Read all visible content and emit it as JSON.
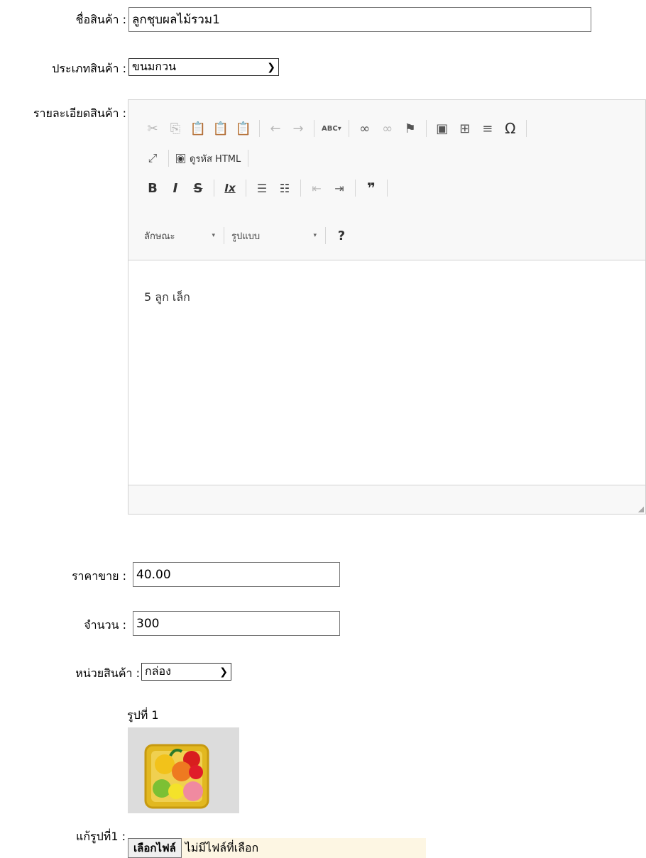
{
  "form": {
    "name_label": "ชื่อสินค้า :",
    "name_value": "ลูกชุบผลไม้รวม1",
    "type_label": "ประเภทสินค้า :",
    "type_value": "ขนมกวน",
    "detail_label": "รายละเอียดสินค้า :",
    "price_label": "ราคาขาย :",
    "price_value": "40.00",
    "qty_label": "จำนวน :",
    "qty_value": "300",
    "unit_label": "หน่วยสินค้า :",
    "unit_value": "กล่อง",
    "image_caption": "รูปที่ 1",
    "edit_image_label": "แก้รูปที่1 :",
    "file_button": "เลือกไฟล์",
    "file_status": "ไม่มีไฟล์ที่เลือก"
  },
  "editor": {
    "content": "5 ลูก เล็ก",
    "source_label": "ดูรหัส HTML",
    "format_label": "ลักษณะ",
    "style_label": "รูปแบบ",
    "help_label": "?",
    "bold": "B",
    "italic": "I",
    "strike": "S",
    "clear_format": "Ix",
    "quote": "❞",
    "spell_label": "ABC",
    "omega": "Ω"
  },
  "colors": {
    "file_status_bg": "#fdf6e3",
    "toolbar_bg": "#f8f8f8"
  }
}
